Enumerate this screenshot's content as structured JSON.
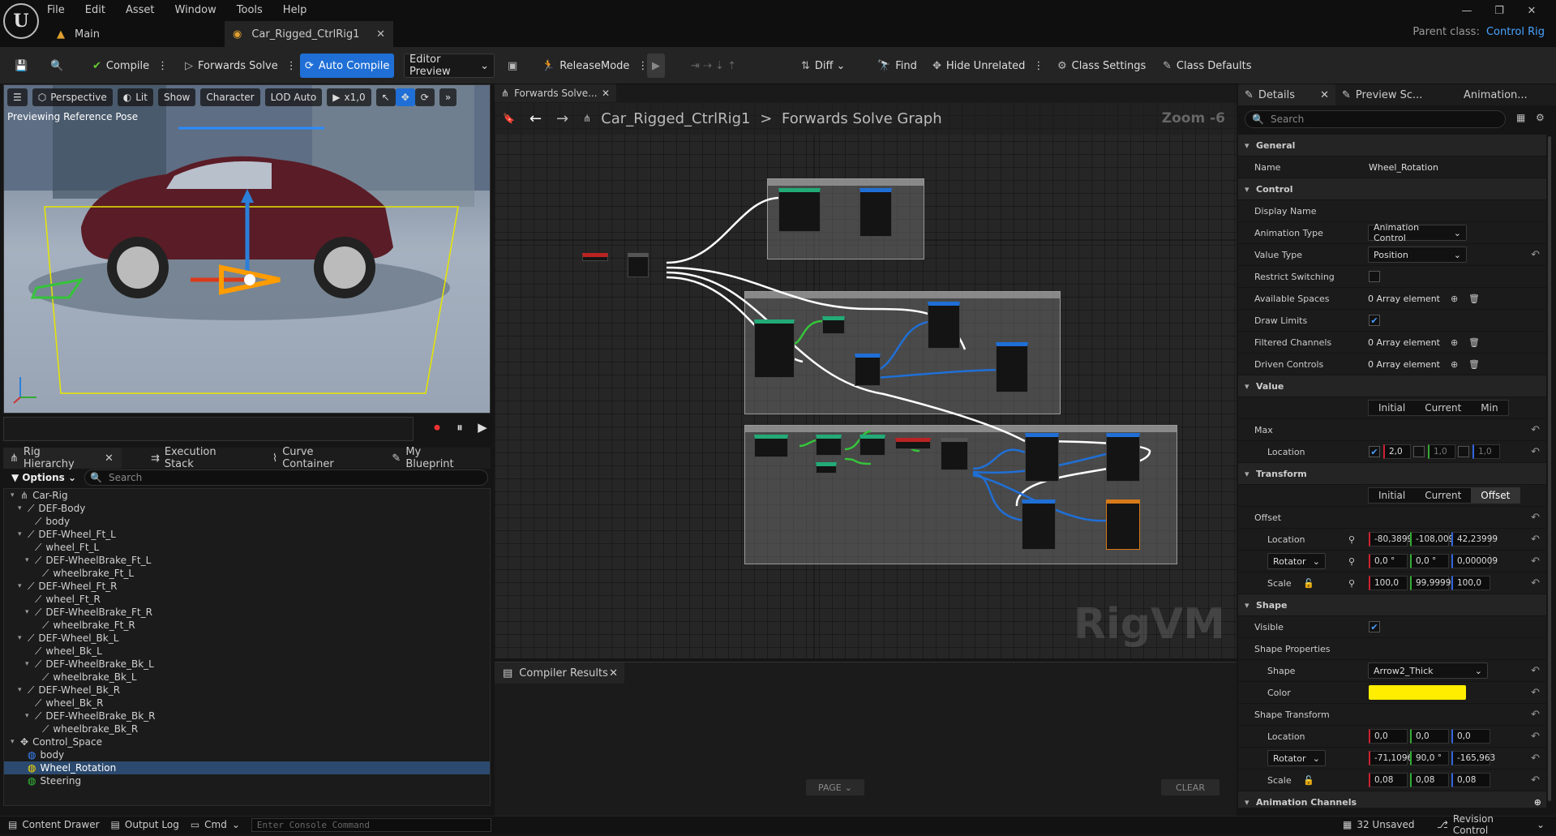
{
  "menu": [
    "File",
    "Edit",
    "Asset",
    "Window",
    "Tools",
    "Help"
  ],
  "tabs": {
    "main": "Main",
    "asset": "Car_Rigged_CtrlRig1"
  },
  "parent_class": {
    "label": "Parent class:",
    "value": "Control Rig"
  },
  "toolbar": {
    "compile": "Compile",
    "forwards_solve": "Forwards Solve",
    "auto_compile": "Auto Compile",
    "editor_preview": "Editor Preview",
    "release_mode": "ReleaseMode",
    "diff": "Diff",
    "find": "Find",
    "hide_unrelated": "Hide Unrelated",
    "class_settings": "Class Settings",
    "class_defaults": "Class Defaults"
  },
  "viewport": {
    "perspective": "Perspective",
    "lit": "Lit",
    "show": "Show",
    "character": "Character",
    "lod": "LOD Auto",
    "speed": "x1,0",
    "preview_label": "Previewing Reference Pose"
  },
  "hierarchy": {
    "tabs": [
      "Rig Hierarchy",
      "Execution Stack",
      "Curve Container",
      "My Blueprint"
    ],
    "options": "Options",
    "search_placeholder": "Search",
    "items": [
      {
        "label": "Car-Rig",
        "indent": 0,
        "kind": "root"
      },
      {
        "label": "DEF-Body",
        "indent": 1,
        "kind": "bone"
      },
      {
        "label": "body",
        "indent": 2,
        "kind": "bone"
      },
      {
        "label": "DEF-Wheel_Ft_L",
        "indent": 1,
        "kind": "bone"
      },
      {
        "label": "wheel_Ft_L",
        "indent": 2,
        "kind": "bone"
      },
      {
        "label": "DEF-WheelBrake_Ft_L",
        "indent": 2,
        "kind": "bone"
      },
      {
        "label": "wheelbrake_Ft_L",
        "indent": 3,
        "kind": "bone"
      },
      {
        "label": "DEF-Wheel_Ft_R",
        "indent": 1,
        "kind": "bone"
      },
      {
        "label": "wheel_Ft_R",
        "indent": 2,
        "kind": "bone"
      },
      {
        "label": "DEF-WheelBrake_Ft_R",
        "indent": 2,
        "kind": "bone"
      },
      {
        "label": "wheelbrake_Ft_R",
        "indent": 3,
        "kind": "bone"
      },
      {
        "label": "DEF-Wheel_Bk_L",
        "indent": 1,
        "kind": "bone"
      },
      {
        "label": "wheel_Bk_L",
        "indent": 2,
        "kind": "bone"
      },
      {
        "label": "DEF-WheelBrake_Bk_L",
        "indent": 2,
        "kind": "bone"
      },
      {
        "label": "wheelbrake_Bk_L",
        "indent": 3,
        "kind": "bone"
      },
      {
        "label": "DEF-Wheel_Bk_R",
        "indent": 1,
        "kind": "bone"
      },
      {
        "label": "wheel_Bk_R",
        "indent": 2,
        "kind": "bone"
      },
      {
        "label": "DEF-WheelBrake_Bk_R",
        "indent": 2,
        "kind": "bone"
      },
      {
        "label": "wheelbrake_Bk_R",
        "indent": 3,
        "kind": "bone"
      },
      {
        "label": "Control_Space",
        "indent": 0,
        "kind": "space"
      },
      {
        "label": "body",
        "indent": 1,
        "kind": "control-blue"
      },
      {
        "label": "Wheel_Rotation",
        "indent": 1,
        "kind": "control-yellow",
        "selected": true
      },
      {
        "label": "Steering",
        "indent": 1,
        "kind": "control-green"
      }
    ]
  },
  "graph": {
    "tab": "Forwards Solve...",
    "breadcrumb_asset": "Car_Rigged_CtrlRig1",
    "breadcrumb_graph": "Forwards Solve Graph",
    "zoom": "Zoom -6",
    "watermark": "RigVM"
  },
  "compiler": {
    "tab": "Compiler Results",
    "page": "PAGE",
    "clear": "CLEAR"
  },
  "details": {
    "tabs": [
      "Details",
      "Preview Sc...",
      "Animation..."
    ],
    "search_placeholder": "Search",
    "general": "General",
    "name_label": "Name",
    "name_value": "Wheel_Rotation",
    "control": "Control",
    "display_name": "Display Name",
    "animation_type_label": "Animation Type",
    "animation_type": "Animation Control",
    "value_type_label": "Value Type",
    "value_type": "Position",
    "restrict_switching": "Restrict Switching",
    "available_spaces": "Available Spaces",
    "array_element": "0 Array element",
    "draw_limits": "Draw Limits",
    "filtered_channels": "Filtered Channels",
    "driven_controls": "Driven Controls",
    "value": "Value",
    "value_tabs": [
      "Initial",
      "Current",
      "Min"
    ],
    "max": "Max",
    "location": "Location",
    "max_location": [
      "2,0",
      "1,0",
      "1,0"
    ],
    "transform": "Transform",
    "transform_tabs": [
      "Initial",
      "Current",
      "Offset"
    ],
    "offset": "Offset",
    "offset_location": [
      "-80,3899",
      "-108,009",
      "42,23999"
    ],
    "rotator": "Rotator",
    "offset_rotator": [
      "0,0 °",
      "0,0 °",
      "0,000009"
    ],
    "scale": "Scale",
    "offset_scale": [
      "100,0",
      "99,99999",
      "100,0"
    ],
    "shape": "Shape",
    "visible": "Visible",
    "shape_properties": "Shape Properties",
    "shape_label": "Shape",
    "shape_value": "Arrow2_Thick",
    "color_label": "Color",
    "color_value": "#ffee00",
    "shape_transform": "Shape Transform",
    "st_location": [
      "0,0",
      "0,0",
      "0,0"
    ],
    "st_rotator": [
      "-71,1096",
      "90,0 °",
      "-165,963"
    ],
    "st_scale": [
      "0,08",
      "0,08",
      "0,08"
    ],
    "animation_channels": "Animation Channels"
  },
  "statusbar": {
    "content_drawer": "Content Drawer",
    "output_log": "Output Log",
    "cmd": "Cmd",
    "console_placeholder": "Enter Console Command",
    "unsaved": "32 Unsaved",
    "revision": "Revision Control"
  },
  "colors": {
    "accent": "#1f6fd6",
    "selection": "#2c4a6f",
    "shape_color": "#ffee00"
  }
}
